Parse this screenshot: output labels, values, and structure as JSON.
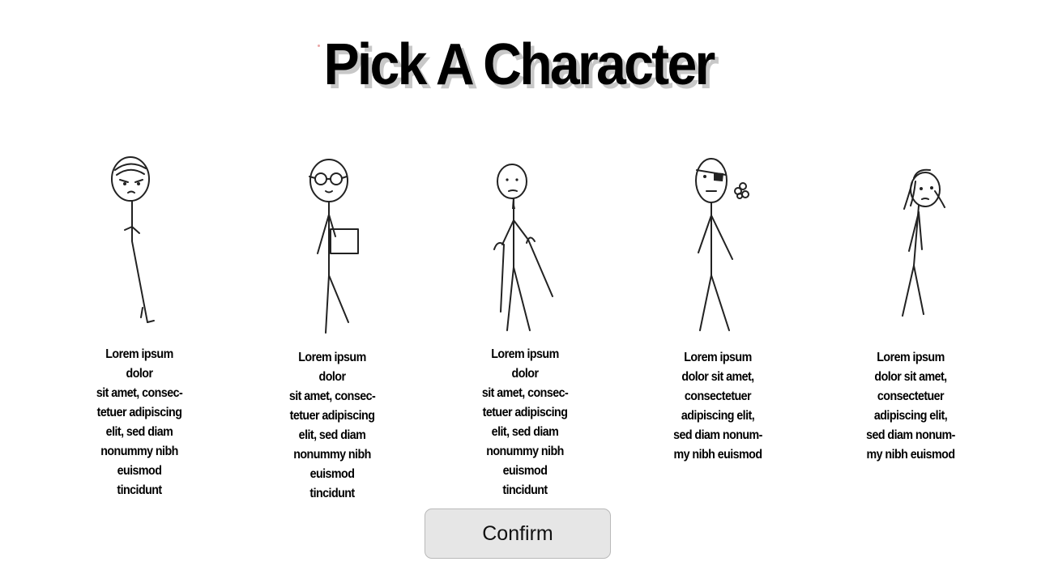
{
  "screen": {
    "title": "Pick A Character"
  },
  "characters": [
    {
      "icon": "angry-stick-figure-icon",
      "description": "Lorem ipsum dolor\nsit amet, consec-\ntetuer adipiscing\nelit, sed diam\nnonummy nibh\neuismod tincidunt"
    },
    {
      "icon": "glasses-stick-figure-with-book-icon",
      "description": "Lorem ipsum dolor\nsit amet, consec-\ntetuer adipiscing\nelit, sed diam\nnonummy nibh\neuismod tincidunt"
    },
    {
      "icon": "elder-stick-figure-with-canes-icon",
      "description": "Lorem ipsum dolor\nsit amet, consec-\ntetuer adipiscing\nelit, sed diam\nnonummy nibh\neuismod tincidunt"
    },
    {
      "icon": "eyepatch-stick-figure-icon",
      "description": "Lorem ipsum\ndolor sit amet,\nconsectetuer\nadipiscing elit,\nsed diam nonum-\nmy nibh euismod"
    },
    {
      "icon": "pigtails-stick-figure-icon",
      "description": "Lorem ipsum\ndolor sit amet,\nconsectetuer\nadipiscing elit,\nsed diam nonum-\nmy nibh euismod"
    }
  ],
  "actions": {
    "confirm_label": "Confirm"
  }
}
